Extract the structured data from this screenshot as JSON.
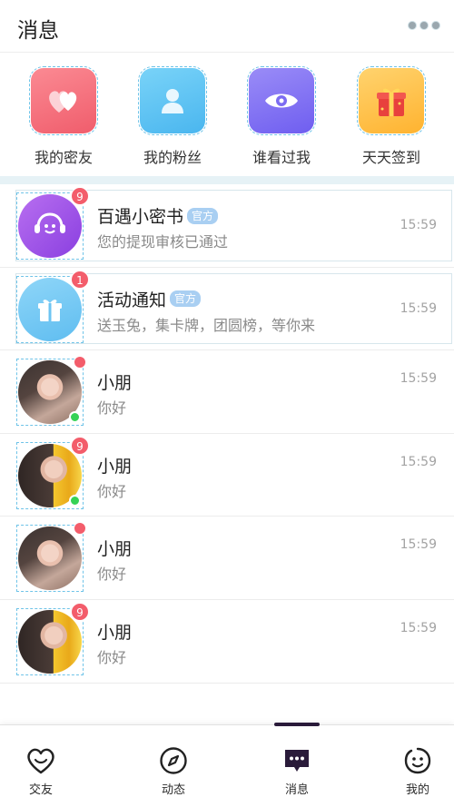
{
  "header": {
    "title": "消息",
    "more_icon": "more-dots-icon"
  },
  "quick_entries": [
    {
      "label": "我的密友",
      "icon": "hearts-icon",
      "color": "#f36c7a"
    },
    {
      "label": "我的粉丝",
      "icon": "person-icon",
      "color": "#5bbdf1"
    },
    {
      "label": "谁看过我",
      "icon": "eye-icon",
      "color": "#7c6cf2"
    },
    {
      "label": "天天签到",
      "icon": "gift-box-icon",
      "color": "#ffc043"
    }
  ],
  "messages": [
    {
      "name": "百遇小密书",
      "tag": "官方",
      "preview": "您的提现审核已通过",
      "time": "15:59",
      "badge": "9",
      "avatar": "assistant-bot-icon"
    },
    {
      "name": "活动通知",
      "tag": "官方",
      "preview": "送玉兔，集卡牌，团圆榜，等你来",
      "time": "15:59",
      "badge": "1",
      "avatar": "gift-icon"
    },
    {
      "name": "小朋",
      "preview": "你好",
      "time": "15:59",
      "badge": "",
      "online": true
    },
    {
      "name": "小朋",
      "preview": "你好",
      "time": "15:59",
      "badge": "9",
      "online": true
    },
    {
      "name": "小朋",
      "preview": "你好",
      "time": "15:59",
      "badge": ""
    },
    {
      "name": "小朋",
      "preview": "你好",
      "time": "15:59",
      "badge": "9"
    }
  ],
  "tabs": [
    {
      "label": "交友",
      "icon": "heart-smile-icon"
    },
    {
      "label": "动态",
      "icon": "compass-icon"
    },
    {
      "label": "消息",
      "icon": "chat-bubble-icon",
      "active": true
    },
    {
      "label": "我的",
      "icon": "smile-face-icon"
    }
  ],
  "colors": {
    "badge": "#f35d6b",
    "online": "#35d255",
    "official_tag": "#a9cff2",
    "active_indicator": "#2a1b3a"
  }
}
